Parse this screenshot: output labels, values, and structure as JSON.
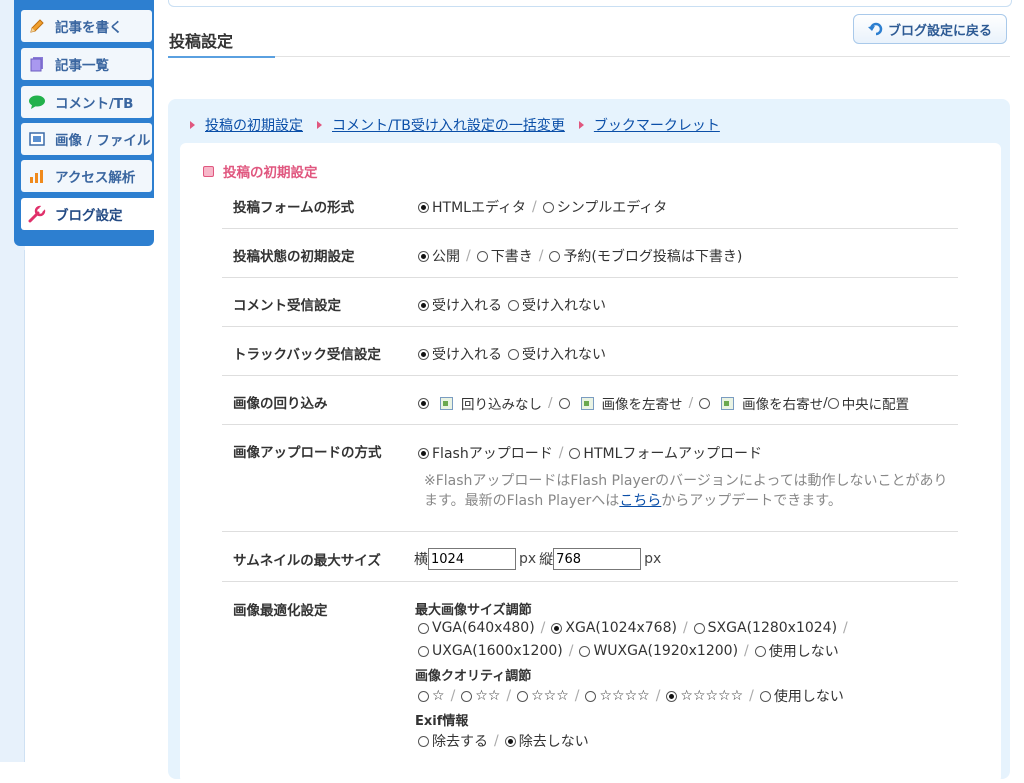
{
  "nav": {
    "items": [
      {
        "label": "記事を書く",
        "icon": "pencil-icon"
      },
      {
        "label": "記事一覧",
        "icon": "document-list-icon"
      },
      {
        "label": "コメント/TB",
        "icon": "speech-bubble-icon"
      },
      {
        "label": "画像 / ファイル",
        "icon": "image-file-icon"
      },
      {
        "label": "アクセス解析",
        "icon": "bar-chart-icon"
      },
      {
        "label": "ブログ設定",
        "icon": "wrench-icon"
      }
    ],
    "active_index": 5
  },
  "header": {
    "title": "投稿設定",
    "back_button": "ブログ設定に戻る"
  },
  "links": [
    "投稿の初期設定",
    "コメント/TB受け入れ設定の一括変更",
    "ブックマークレット"
  ],
  "section_title": "投稿の初期設定",
  "colors": {
    "nav_bg": "#2d7fd0",
    "accent_pink": "#e0577f",
    "panel_bg": "#e6f3fd",
    "link": "#0b4fa8"
  },
  "rows": {
    "form_type": {
      "label": "投稿フォームの形式",
      "options": [
        "HTMLエディタ",
        "シンプルエディタ"
      ],
      "selected": 0
    },
    "post_state": {
      "label": "投稿状態の初期設定",
      "options": [
        "公開",
        "下書き",
        "予約(モブログ投稿は下書き)"
      ],
      "selected": 0
    },
    "comment": {
      "label": "コメント受信設定",
      "options": [
        "受け入れる",
        "受け入れない"
      ],
      "selected": 0
    },
    "trackback": {
      "label": "トラックバック受信設定",
      "options": [
        "受け入れる",
        "受け入れない"
      ],
      "selected": 0
    },
    "wrap": {
      "label": "画像の回り込み",
      "options": [
        "回り込みなし",
        "画像を左寄せ",
        "画像を右寄せ",
        "中央に配置"
      ],
      "selected": 0
    },
    "upload": {
      "label": "画像アップロードの方式",
      "options": [
        "Flashアップロード",
        "HTMLフォームアップロード"
      ],
      "selected": 0,
      "note_before": "※FlashアップロードはFlash Playerのバージョンによっては動作しないことがあります。最新のFlash Playerへは",
      "note_link": "こちら",
      "note_after": "からアップデートできます。"
    },
    "thumb": {
      "label": "サムネイルの最大サイズ",
      "w_prefix": "横",
      "w_value": "1024",
      "px": "px",
      "h_prefix": "縦",
      "h_value": "768"
    },
    "optimize": {
      "label": "画像最適化設定",
      "size_heading": "最大画像サイズ調節",
      "size_options": [
        "VGA(640x480)",
        "XGA(1024x768)",
        "SXGA(1280x1024)",
        "UXGA(1600x1200)",
        "WUXGA(1920x1200)",
        "使用しない"
      ],
      "size_selected": 1,
      "quality_heading": "画像クオリティ調節",
      "quality_options": [
        "☆",
        "☆☆",
        "☆☆☆",
        "☆☆☆☆",
        "☆☆☆☆☆",
        "使用しない"
      ],
      "quality_selected": 4,
      "exif_heading": "Exif情報",
      "exif_options": [
        "除去する",
        "除去しない"
      ],
      "exif_selected": 1
    }
  }
}
